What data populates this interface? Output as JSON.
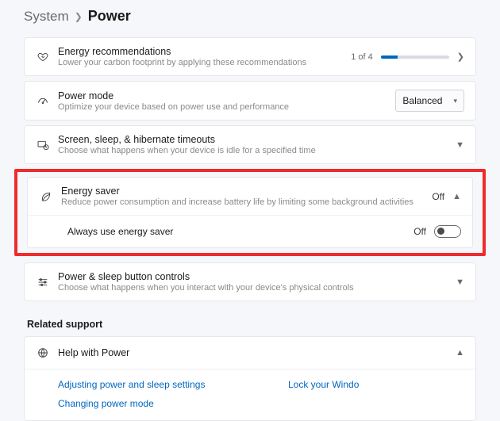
{
  "breadcrumb": {
    "parent": "System",
    "current": "Power"
  },
  "items": {
    "energy_rec": {
      "title": "Energy recommendations",
      "sub": "Lower your carbon footprint by applying these recommendations",
      "counter": "1 of 4"
    },
    "power_mode": {
      "title": "Power mode",
      "sub": "Optimize your device based on power use and performance",
      "value": "Balanced"
    },
    "timeouts": {
      "title": "Screen, sleep, & hibernate timeouts",
      "sub": "Choose what happens when your device is idle for a specified time"
    },
    "energy_saver": {
      "title": "Energy saver",
      "sub": "Reduce power consumption and increase battery life by limiting some background activities",
      "status": "Off",
      "always": {
        "label": "Always use energy saver",
        "status": "Off"
      }
    },
    "buttons": {
      "title": "Power & sleep button controls",
      "sub": "Choose what happens when you interact with your device's physical controls"
    }
  },
  "related_support": "Related support",
  "help": {
    "title": "Help with Power",
    "links": {
      "adjust": "Adjusting power and sleep settings",
      "change": "Changing power mode",
      "lock": "Lock your Windo"
    }
  }
}
